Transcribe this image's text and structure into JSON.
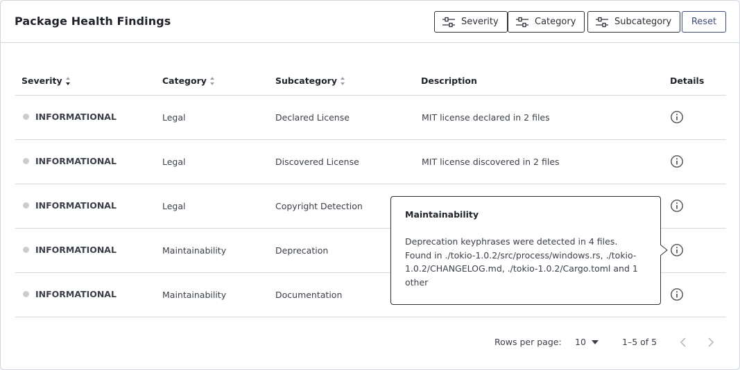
{
  "header": {
    "title": "Package Health Findings",
    "filters": {
      "severity": "Severity",
      "category": "Category",
      "subcategory": "Subcategory"
    },
    "reset_label": "Reset"
  },
  "table": {
    "columns": {
      "severity": "Severity",
      "category": "Category",
      "subcategory": "Subcategory",
      "description": "Description",
      "details": "Details"
    },
    "rows": [
      {
        "severity": "INFORMATIONAL",
        "category": "Legal",
        "subcategory": "Declared License",
        "description": "MIT license declared in 2 files"
      },
      {
        "severity": "INFORMATIONAL",
        "category": "Legal",
        "subcategory": "Discovered License",
        "description": "MIT license discovered in 2 files"
      },
      {
        "severity": "INFORMATIONAL",
        "category": "Legal",
        "subcategory": "Copyright Detection",
        "description": ""
      },
      {
        "severity": "INFORMATIONAL",
        "category": "Maintainability",
        "subcategory": "Deprecation",
        "description": ""
      },
      {
        "severity": "INFORMATIONAL",
        "category": "Maintainability",
        "subcategory": "Documentation",
        "description": ""
      }
    ]
  },
  "tooltip": {
    "title": "Maintainability",
    "body": "Deprecation keyphrases were detected in 4 files. Found in ./tokio-1.0.2/src/process/windows.rs, ./tokio-1.0.2/CHANGELOG.md, ./tokio-1.0.2/Cargo.toml and 1 other"
  },
  "pagination": {
    "rows_per_page_label": "Rows per page:",
    "rows_per_page_value": "10",
    "range": "1–5 of 5"
  },
  "colors": {
    "severity_dot": "#c9ccd1",
    "border": "#d4d7dc",
    "accent": "#3d4a73"
  },
  "icons": {
    "filter": "sliders-icon",
    "info": "info-circle-icon",
    "sort": "sort-arrows-icon",
    "prev": "chevron-left-icon",
    "next": "chevron-right-icon",
    "dropdown": "caret-down-icon"
  }
}
